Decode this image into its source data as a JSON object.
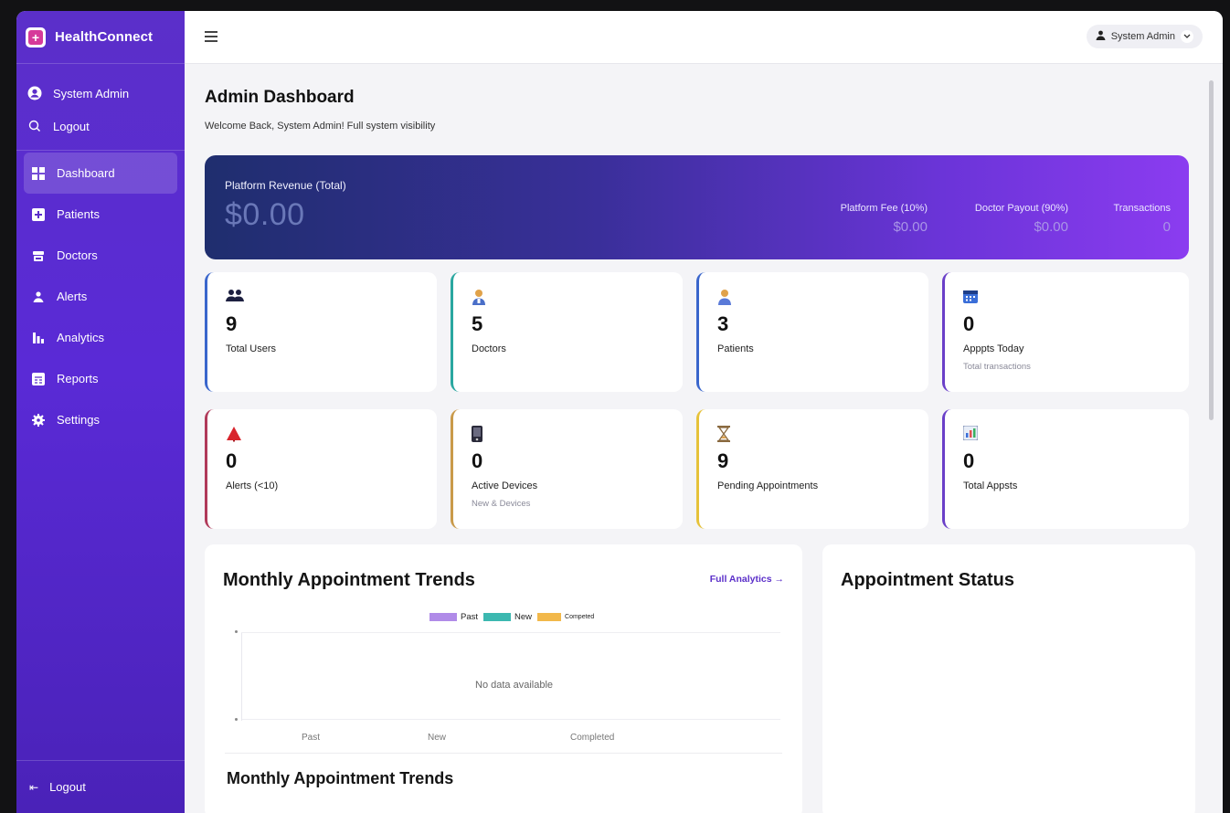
{
  "app": {
    "brand_name": "HealthConnect",
    "brand_icon": "plus-logo"
  },
  "sidebar": {
    "user_name": "System Admin",
    "logout_top": "Logout",
    "items": [
      {
        "label": "Dashboard",
        "icon": "grid-icon",
        "active": true
      },
      {
        "label": "Patients",
        "icon": "medical-plus-icon"
      },
      {
        "label": "Doctors",
        "icon": "doctor-icon"
      },
      {
        "label": "Alerts",
        "icon": "alert-person-icon"
      },
      {
        "label": "Analytics",
        "icon": "bar-chart-icon"
      },
      {
        "label": "Reports",
        "icon": "report-icon"
      },
      {
        "label": "Settings",
        "icon": "gear-icon"
      }
    ],
    "logout_bottom": "Logout"
  },
  "topbar": {
    "user_label": "System Admin"
  },
  "page": {
    "title": "Admin Dashboard",
    "subtitle": "Welcome Back, System Admin! Full system visibility"
  },
  "revenue": {
    "label": "Platform Revenue (Total)",
    "total": "$0.00",
    "stats": [
      {
        "label": "Platform Fee (10%)",
        "value": "$0.00"
      },
      {
        "label": "Doctor Payout (90%)",
        "value": "$0.00"
      },
      {
        "label": "Transactions",
        "value": "0"
      }
    ]
  },
  "cards": [
    {
      "value": "9",
      "label": "Total Users",
      "sub": "",
      "icon": "users-icon",
      "accent": "#3a66cc"
    },
    {
      "value": "5",
      "label": "Doctors",
      "sub": "",
      "icon": "doctor-icon",
      "accent": "#2aa7a0"
    },
    {
      "value": "3",
      "label": "Patients",
      "sub": "",
      "icon": "patient-icon",
      "accent": "#3a66cc"
    },
    {
      "value": "0",
      "label": "Apppts Today",
      "sub": "Total transactions",
      "icon": "calendar-icon",
      "accent": "#6a3fc8"
    },
    {
      "value": "0",
      "label": "Alerts (<10)",
      "sub": "",
      "icon": "warning-icon",
      "accent": "#b03a5a"
    },
    {
      "value": "0",
      "label": "Active Devices",
      "sub": "New & Devices",
      "icon": "device-icon",
      "accent": "#c99a4a"
    },
    {
      "value": "9",
      "label": "Pending Appointments",
      "sub": "",
      "icon": "hourglass-icon",
      "accent": "#e6c23a"
    },
    {
      "value": "0",
      "label": "Total Appsts",
      "sub": "",
      "icon": "chart-icon",
      "accent": "#6a3fc8"
    }
  ],
  "trends": {
    "title": "Monthly Appointment Trends",
    "link": "Full Analytics →",
    "legend": [
      {
        "name": "Past",
        "color": "#b08be8"
      },
      {
        "name": "New",
        "color": "#3cb8b0"
      },
      {
        "name": "Competed",
        "color": "#f2b84a"
      }
    ],
    "empty_text": "No data available",
    "x_labels": [
      "Past",
      "New",
      "Completed"
    ],
    "second_title": "Monthly Appointment Trends"
  },
  "status": {
    "title": "Appointment Status"
  }
}
